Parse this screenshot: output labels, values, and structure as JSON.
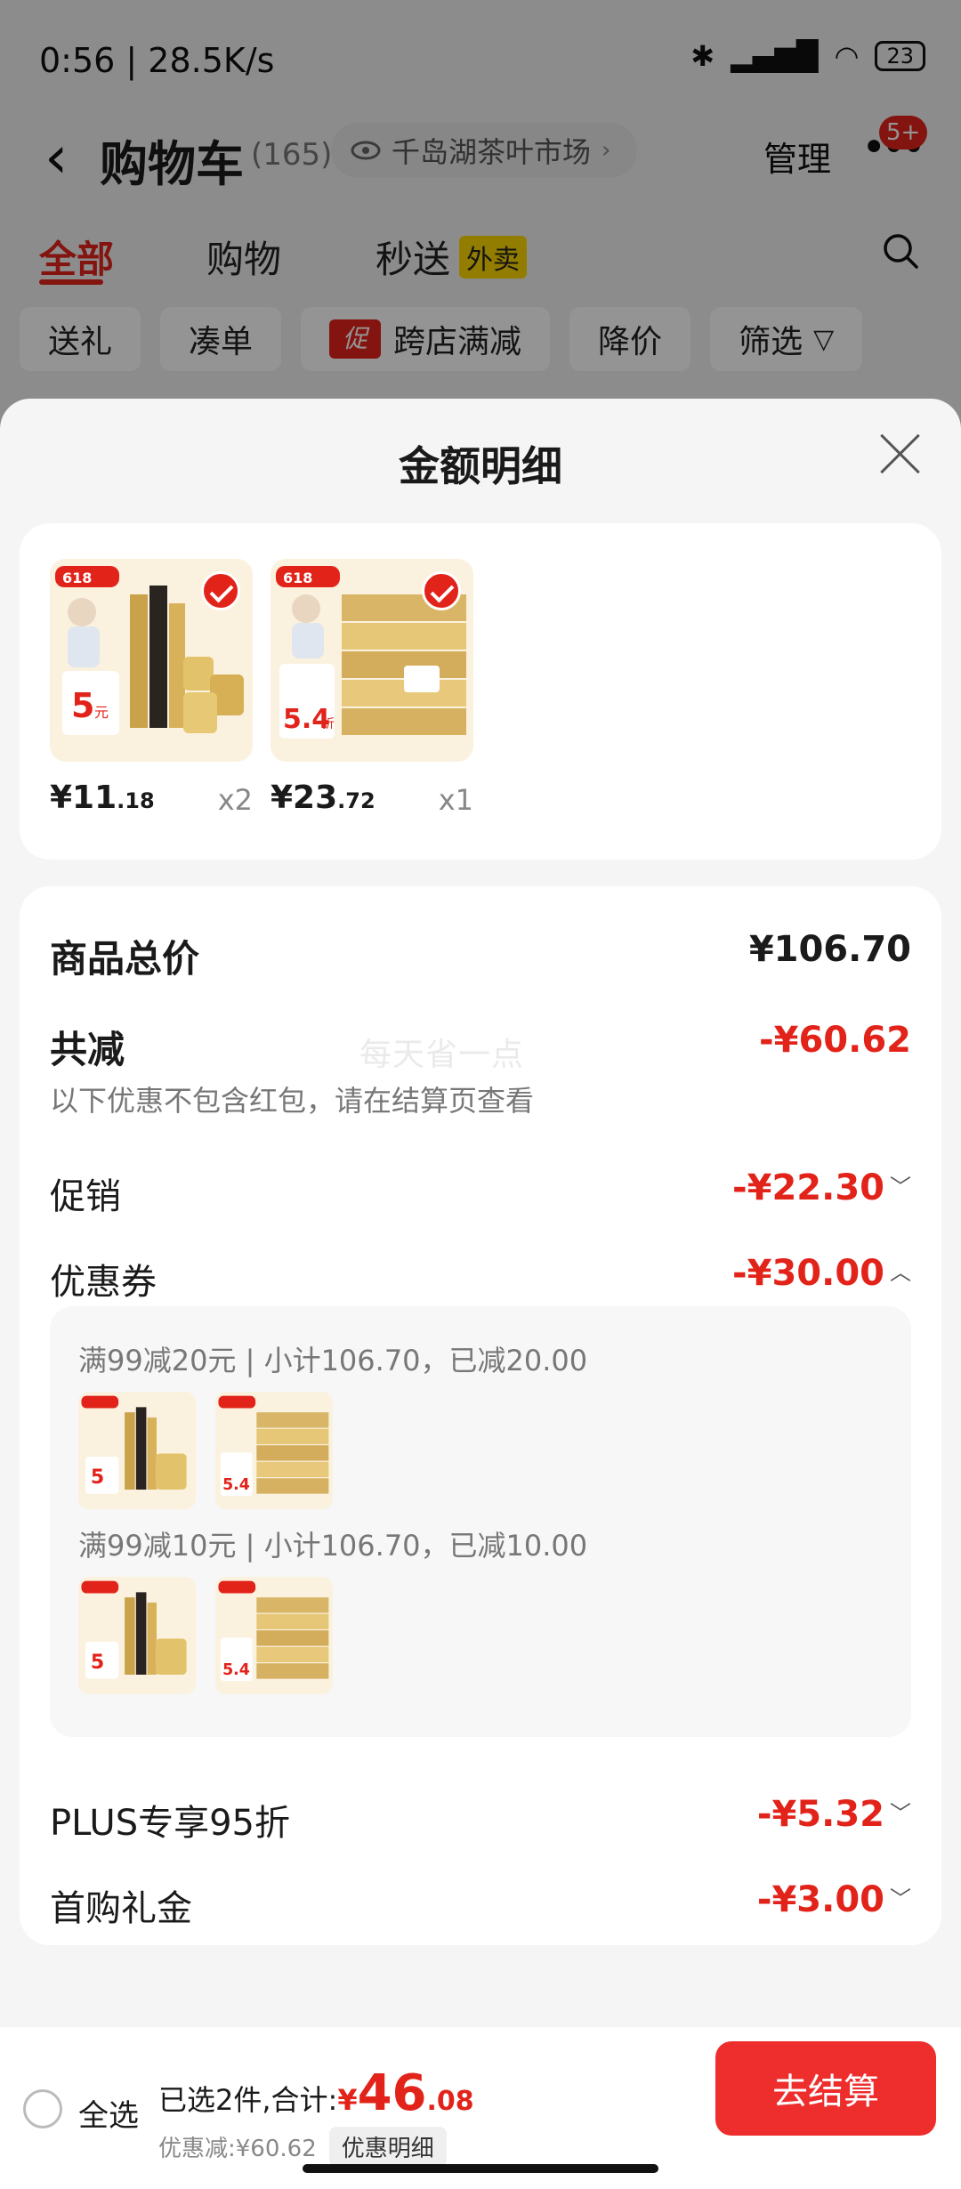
{
  "status_bar": {
    "time": "0:56 | 28.5K/s",
    "battery": "23"
  },
  "header": {
    "title": "购物车",
    "count": "(165)",
    "store_name": "千岛湖茶叶市场",
    "manage_label": "管理",
    "more_badge": "5+"
  },
  "tabs": [
    {
      "label": "全部"
    },
    {
      "label": "购物"
    },
    {
      "label": "秒送"
    }
  ],
  "waimai_tag": "外卖",
  "filter_chips": [
    {
      "label": "送礼"
    },
    {
      "label": "凑单"
    },
    {
      "label": "跨店满减",
      "tag": "促"
    },
    {
      "label": "降价"
    },
    {
      "label": "筛选"
    }
  ],
  "sheet": {
    "title": "金额明细",
    "goods": [
      {
        "price_int": "¥11",
        "price_dec": ".18",
        "qty": "x2",
        "promo_badge": "618",
        "price_tag": "5",
        "price_tag_unit": "元",
        "product": "paper-rolls"
      },
      {
        "price_int": "¥23",
        "price_dec": ".72",
        "qty": "x1",
        "promo_badge": "618",
        "price_tag": "5.4",
        "price_tag_unit": "折",
        "product": "tissue-boxes"
      }
    ],
    "summary": {
      "total_label": "商品总价",
      "total_value": "¥106.70",
      "reduce_label": "共减",
      "reduce_value": "-¥60.62",
      "reduce_note": "以下优惠不包含红包，请在结算页查看",
      "watermark": "每天省一点"
    },
    "lines": [
      {
        "label": "促销",
        "value": "-¥22.30",
        "chevron": "down"
      },
      {
        "label": "优惠券",
        "value": "-¥30.00",
        "chevron": "up"
      },
      {
        "label": "PLUS专享95折",
        "value": "-¥5.32",
        "chevron": "down"
      },
      {
        "label": "首购礼金",
        "value": "-¥3.00",
        "chevron": "down"
      }
    ],
    "coupon_groups": [
      {
        "title": "满99减20元 | 小计106.70，已减20.00"
      },
      {
        "title": "满99减10元 | 小计106.70，已减10.00"
      }
    ]
  },
  "bottom_bar": {
    "select_all": "全选",
    "selected_prefix": "已选2件,合计:",
    "yen": "¥",
    "total_int": "46",
    "total_dec": ".08",
    "discount_text": "优惠减:¥60.62",
    "discount_detail": "优惠明细",
    "checkout": "去结算"
  },
  "colors": {
    "accent": "#e2231a",
    "checkout": "#ee2d2d",
    "waimai": "#fdd800"
  }
}
